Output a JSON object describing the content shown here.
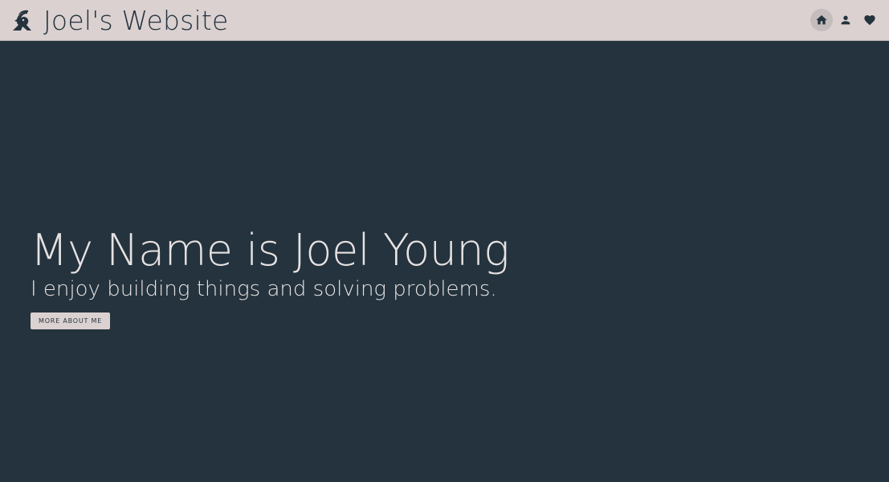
{
  "header": {
    "title": "Joel's Website",
    "logo_icon": "goat-logo-icon",
    "nav": [
      {
        "name": "home",
        "icon": "home-icon",
        "active": true
      },
      {
        "name": "about",
        "icon": "person-icon",
        "active": false
      },
      {
        "name": "favorites",
        "icon": "heart-icon",
        "active": false
      }
    ]
  },
  "hero": {
    "title": "My Name is Joel Young",
    "subtitle": "I enjoy building things and solving problems.",
    "button_label": "MORE ABOUT ME"
  },
  "colors": {
    "header_bg": "#dbd1d1",
    "hero_bg": "#24333d",
    "text_light": "#e7e2e2",
    "text_dark": "#25333d"
  }
}
